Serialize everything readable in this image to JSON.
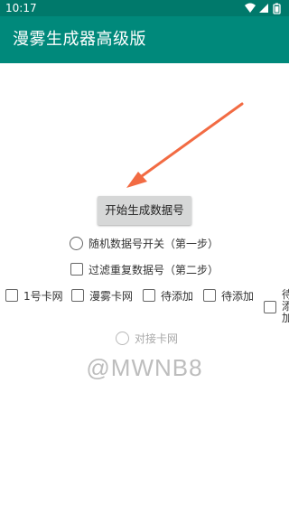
{
  "status_bar": {
    "time": "10:17",
    "icons": [
      "wifi-icon",
      "signal-icon",
      "battery-icon"
    ]
  },
  "app_bar": {
    "title": "漫雾生成器高级版",
    "color": "#00897b"
  },
  "annotation": {
    "arrow_color": "#f26b43"
  },
  "main_button": {
    "label": "开始生成数据号"
  },
  "options": {
    "random_switch": {
      "label": "随机数据号开关（第一步）",
      "checked": false
    },
    "filter_duplicates": {
      "label": "过滤重复数据号（第二步）",
      "checked": false
    },
    "cards": [
      {
        "label": "1号卡网",
        "checked": false
      },
      {
        "label": "漫雾卡网",
        "checked": false
      },
      {
        "label": "待添加",
        "checked": false
      },
      {
        "label": "待添加",
        "checked": false
      },
      {
        "label": "待添加",
        "checked": false
      }
    ],
    "connect_card": {
      "label": "对接卡网",
      "enabled": false
    }
  },
  "watermark": "@MWNB8"
}
